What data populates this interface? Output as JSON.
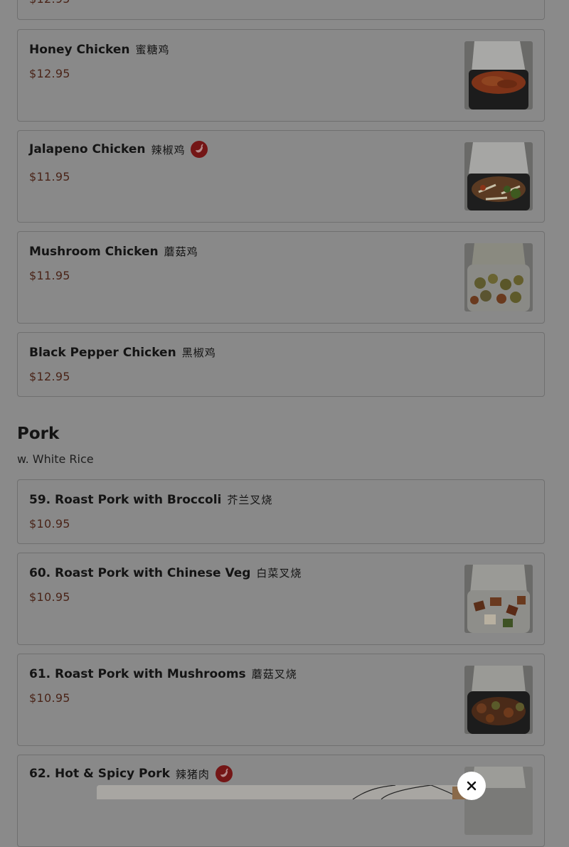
{
  "top_partial_price": "$12.95",
  "chicken_items": [
    {
      "name": "Honey Chicken",
      "cjk": "蜜糖鸡",
      "price": "$12.95"
    },
    {
      "name": "Jalapeno Chicken",
      "cjk": "辣椒鸡",
      "price": "$11.95",
      "spicy": true
    },
    {
      "name": "Mushroom Chicken",
      "cjk": "蘑菇鸡",
      "price": "$11.95"
    },
    {
      "name": "Black Pepper Chicken",
      "cjk": "黑椒鸡",
      "price": "$12.95"
    }
  ],
  "pork_section": {
    "title": "Pork",
    "subtitle": "w. White Rice",
    "items": [
      {
        "name": "59. Roast Pork with Broccoli",
        "cjk": "芥兰叉烧",
        "price": "$10.95"
      },
      {
        "name": "60. Roast Pork with Chinese Veg",
        "cjk": "白菜叉烧",
        "price": "$10.95"
      },
      {
        "name": "61. Roast Pork with Mushrooms",
        "cjk": "蘑菇叉烧",
        "price": "$10.95"
      },
      {
        "name": "62. Hot & Spicy Pork",
        "cjk": "辣猪肉",
        "price": "",
        "spicy": true
      }
    ]
  },
  "icons": {
    "spicy": "chili-pepper-icon",
    "close": "close-icon"
  },
  "colors": {
    "price": "#4a2418",
    "spicy_badge": "#741616",
    "overlay": "#8a8a8a"
  }
}
